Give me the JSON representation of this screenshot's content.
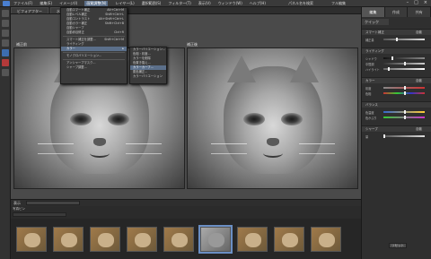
{
  "app": {
    "title": "Photoshop Elements"
  },
  "menubar": {
    "items": [
      "ファイル(F)",
      "編集(E)",
      "イメージ(I)",
      "画質調整(N)",
      "レイヤー(L)",
      "選択範囲(S)",
      "フィルター(T)",
      "表示(V)",
      "ウィンドウ(W)",
      "ヘルプ(H)"
    ],
    "right_items": [
      "パネル名を検索",
      "フル編集"
    ]
  },
  "doc_tabs": [
    "ビフォアフター",
    "水平方向"
  ],
  "panels": {
    "before_label": "補正前",
    "after_label": "補正後"
  },
  "dropdown": {
    "items": [
      {
        "label": "自動スマート補正",
        "shortcut": "Alt+Ctrl+M"
      },
      {
        "label": "自動レベル補正",
        "shortcut": "Shift+Ctrl+L"
      },
      {
        "label": "自動コントラスト",
        "shortcut": "Alt+Shift+Ctrl+L"
      },
      {
        "label": "自動カラー補正",
        "shortcut": "Shift+Ctrl+B"
      },
      {
        "label": "自動シャープ",
        "shortcut": ""
      },
      {
        "label": "自動赤目修正",
        "shortcut": "Ctrl+R"
      },
      {
        "label": "スマート補正を調整...",
        "shortcut": "Shift+Ctrl+M"
      },
      {
        "label": "ライティング",
        "shortcut": ""
      },
      {
        "label": "カラー",
        "shortcut": ""
      },
      {
        "label": "モノクロバリエーション...",
        "shortcut": ""
      },
      {
        "label": "アンシャープマスク...",
        "shortcut": ""
      },
      {
        "label": "シャープ調整...",
        "shortcut": ""
      }
    ],
    "highlighted_index": 8
  },
  "submenu": {
    "items": [
      "カラーバリエーション...",
      "色相・彩度...",
      "カラーを削除",
      "色置き換え...",
      "カラーカーブ...",
      "肌色補正...",
      "カラーバリエーション"
    ],
    "highlighted_index": 4
  },
  "statusbar": {
    "zoom": "表示"
  },
  "photobin": {
    "label": "写真ビン",
    "source": "開いているファイルを表示",
    "thumb_count": 10,
    "selected_index": 5
  },
  "right_panel": {
    "tabs": [
      "編集",
      "作成",
      "共有"
    ],
    "active_tab": 0,
    "subtab": "クイック",
    "sections": [
      {
        "name": "スマート補正",
        "option": "自動",
        "sliders": [
          {
            "label": "補正量",
            "value": 0.3
          }
        ]
      },
      {
        "name": "ライティング",
        "option": "",
        "sliders": [
          {
            "label": "シャドウ",
            "value": 0.2
          },
          {
            "label": "中間調",
            "value": 0.5
          },
          {
            "label": "ハイライト",
            "value": 0.1
          }
        ]
      },
      {
        "name": "カラー",
        "option": "自動",
        "sliders": [
          {
            "label": "彩度",
            "value": 0.5
          },
          {
            "label": "色相",
            "value": 0.5
          }
        ]
      },
      {
        "name": "バランス",
        "option": "",
        "sliders": [
          {
            "label": "色温度",
            "value": 0.5
          },
          {
            "label": "色かぶり",
            "value": 0.5
          }
        ]
      },
      {
        "name": "シャープ",
        "option": "自動",
        "sliders": [
          {
            "label": "量",
            "value": 0.0
          }
        ]
      }
    ],
    "reset_label": "リセット"
  }
}
